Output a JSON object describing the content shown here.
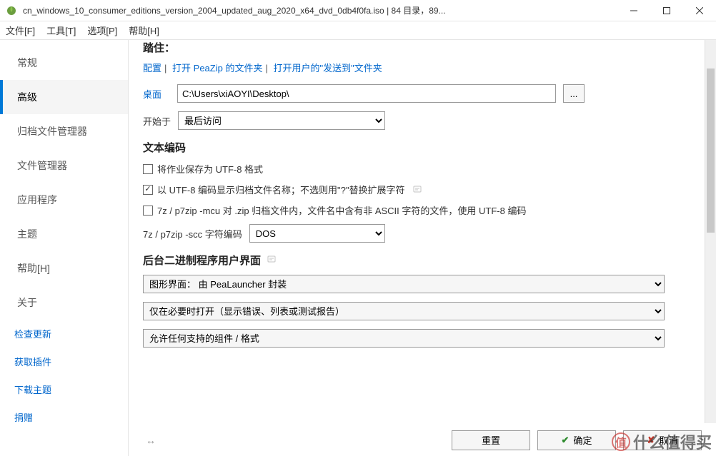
{
  "titlebar": {
    "text": "cn_windows_10_consumer_editions_version_2004_updated_aug_2020_x64_dvd_0db4f0fa.iso | 84 目录，89..."
  },
  "menubar": {
    "file": "文件[F]",
    "tools": "工具[T]",
    "options": "选项[P]",
    "help": "帮助[H]"
  },
  "sidebar": {
    "items": [
      "常规",
      "高级",
      "归档文件管理器",
      "文件管理器",
      "应用程序",
      "主题",
      "帮助[H]",
      "关于"
    ],
    "links": [
      "检查更新",
      "获取插件",
      "下载主题",
      "捐赠"
    ]
  },
  "paths": {
    "heading_truncated": "踏住：",
    "link_config": "配置",
    "link_open_peazip": "打开 PeaZip 的文件夹",
    "link_open_sendto": "打开用户的\"发送到\"文件夹",
    "desktop_label": "桌面",
    "desktop_value": "C:\\Users\\xiAOYI\\Desktop\\",
    "browse": "...",
    "start_label": "开始于",
    "start_value": "最后访问"
  },
  "encoding": {
    "heading": "文本编码",
    "cb_utf8_save": "将作业保存为 UTF-8 格式",
    "cb_utf8_filenames": "以 UTF-8 编码显示归档文件名称；不选则用\"?\"替换扩展字符",
    "cb_7z_mcu": "7z / p7zip -mcu 对 .zip 归档文件内，文件名中含有非 ASCII 字符的文件，使用 UTF-8 编码",
    "scc_label": "7z / p7zip -scc 字符编码",
    "scc_value": "DOS"
  },
  "backend": {
    "heading": "后台二进制程序用户界面",
    "gui_wrap": "图形界面：   由 PeaLauncher 封装",
    "open_policy": "仅在必要时打开（显示错误、列表或测试报告）",
    "formats": "允许任何支持的组件 / 格式"
  },
  "footer": {
    "reset": "重置",
    "ok": "确定",
    "cancel": "取消"
  },
  "watermark": "什么值得买"
}
